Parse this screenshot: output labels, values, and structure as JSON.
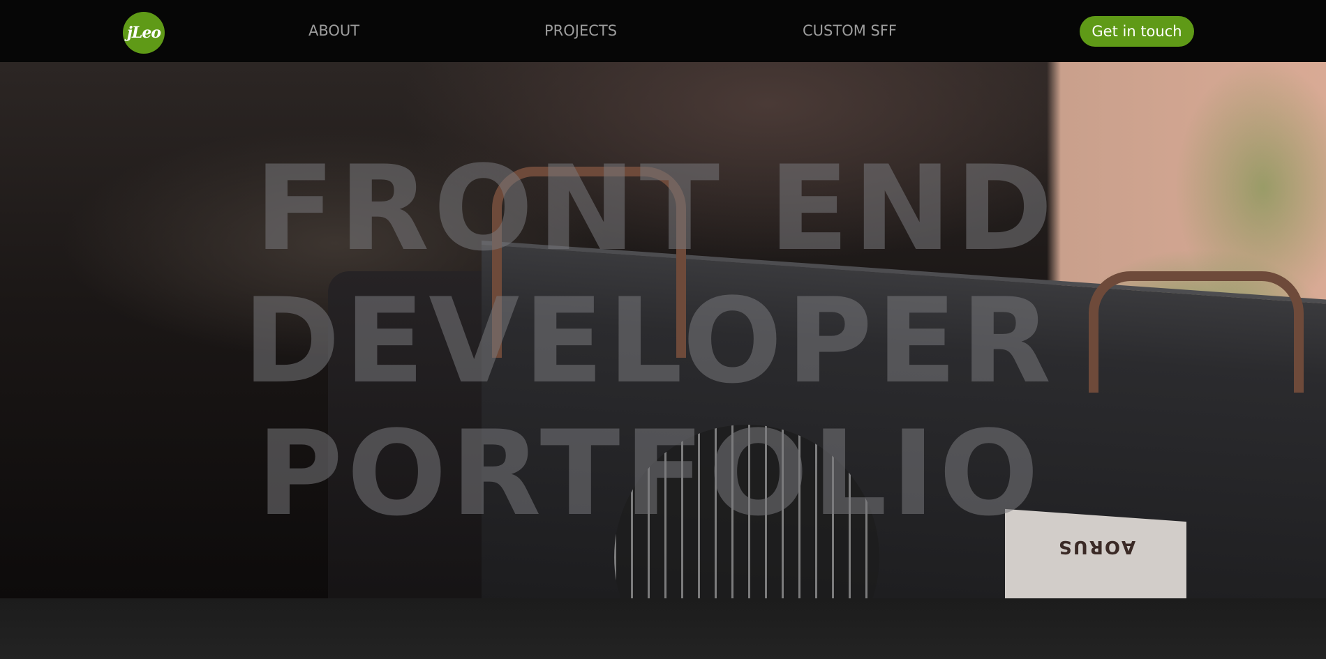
{
  "nav": {
    "logo_text": "jLeo",
    "links": [
      {
        "label": "ABOUT"
      },
      {
        "label": "PROJECTS"
      },
      {
        "label": "CUSTOM SFF"
      }
    ],
    "cta_label": "Get in touch"
  },
  "hero": {
    "title_lines": [
      "FRONT END",
      "DEVELOPER",
      "PORTFOLIO"
    ],
    "background_label": "AORUS"
  },
  "colors": {
    "accent": "#5f9a17",
    "nav_bg": "#060606",
    "nav_text": "#9c9c9c"
  }
}
